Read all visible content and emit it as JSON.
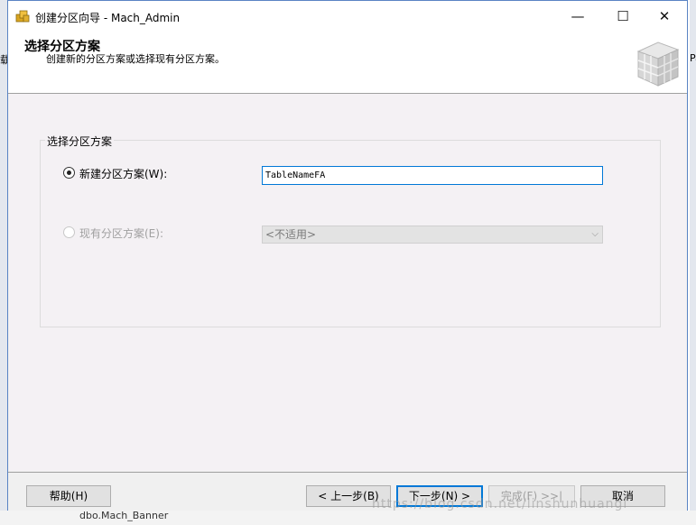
{
  "window": {
    "title": "创建分区向导 - Mach_Admin",
    "minimize_glyph": "—",
    "maximize_glyph": "☐",
    "close_glyph": "✕"
  },
  "header": {
    "title": "选择分区方案",
    "subtitle": "创建新的分区方案或选择现有分区方案。"
  },
  "group": {
    "label": "选择分区方案",
    "new_option": {
      "label": "新建分区方案(W):",
      "selected": true,
      "value": "TableNameFA"
    },
    "existing_option": {
      "label": "现有分区方案(E):",
      "selected": false,
      "enabled": false,
      "value": "<不适用>"
    }
  },
  "buttons": {
    "help": "帮助(H)",
    "back": "< 上一步(B)",
    "next": "下一步(N) >",
    "finish": "完成(F) >>|",
    "cancel": "取消"
  },
  "background": {
    "left_fragment": "载",
    "right_fragment": "Pa",
    "bottom_text": "dbo.Mach_Banner"
  },
  "watermark": "https://blog.csdn.net/linshunhuangl",
  "colors": {
    "accent": "#0078d7",
    "window_border": "#5a84c4",
    "content_bg": "#f4f1f4"
  }
}
